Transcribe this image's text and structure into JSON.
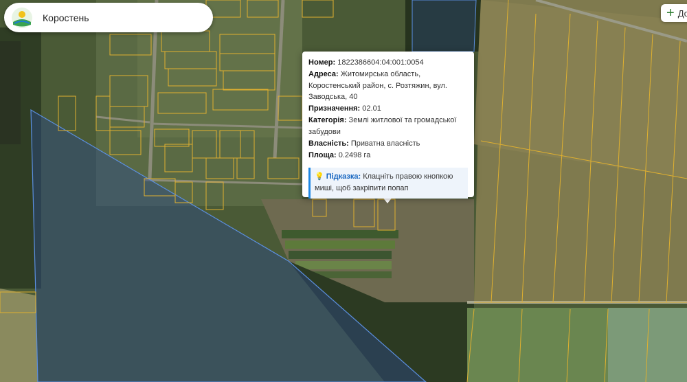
{
  "search": {
    "value": "Коростень"
  },
  "toolbar": {
    "add_label": "До"
  },
  "popup": {
    "number_label": "Номер:",
    "number_value": "1822386604:04:001:0054",
    "address_label": "Адреса:",
    "address_value": "Житомирська область, Коростенський район, с. Розтяжин, вул. Заводська, 40",
    "purpose_label": "Призначення:",
    "purpose_value": "02.01",
    "category_label": "Категорія:",
    "category_value": "Землі житлової та громадської забудови",
    "ownership_label": "Власність:",
    "ownership_value": "Приватна власність",
    "area_label": "Площа:",
    "area_value": "0.2498 га",
    "hint_label": "Підказка:",
    "hint_text": "Клацніть правою кнопкою миші, щоб закріпити попап"
  },
  "colors": {
    "parcel_border": "#e0b030",
    "forest_zone_fill": "#2a4a8a",
    "forest_zone_border": "#5b8fe0",
    "hint_accent": "#1e88e5"
  },
  "icons": {
    "logo": "city-emblem-icon",
    "add": "plus-icon",
    "hint": "lightbulb-icon"
  }
}
